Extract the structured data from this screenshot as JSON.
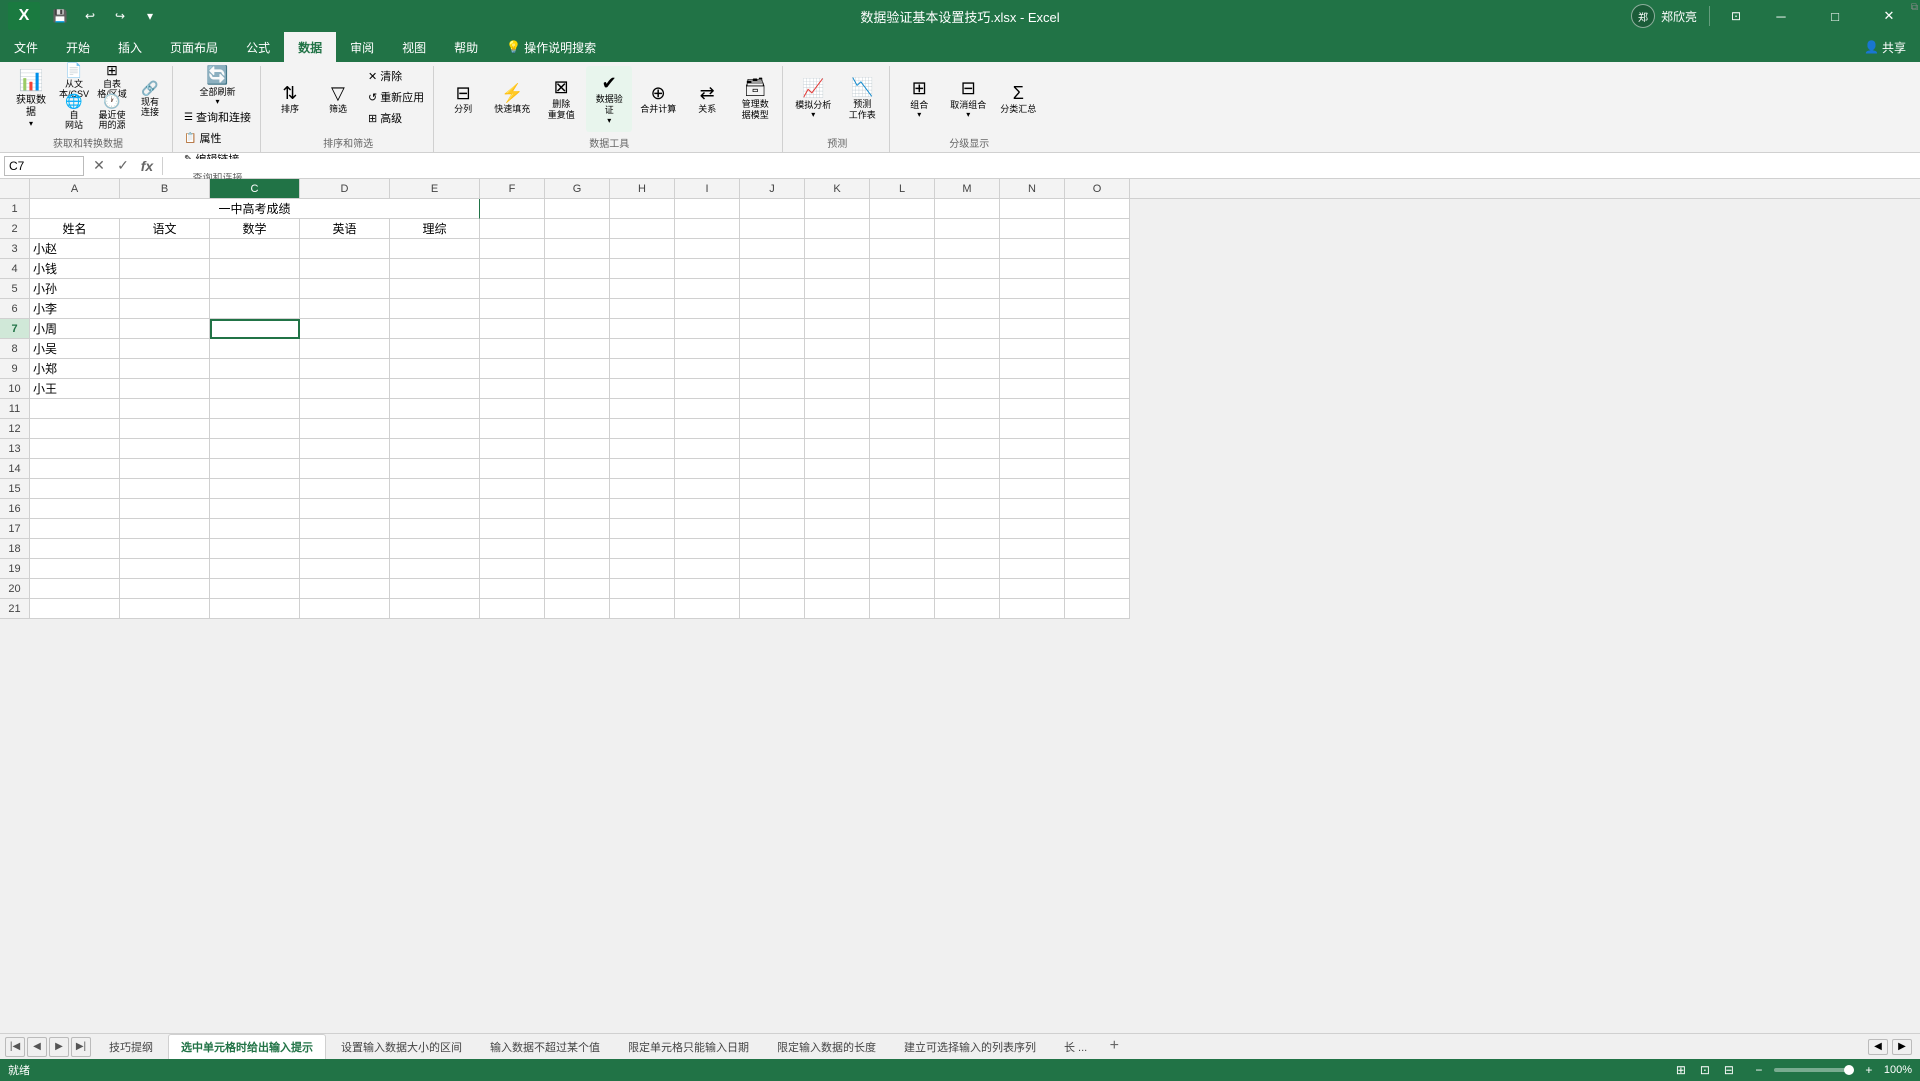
{
  "title_bar": {
    "file_title": "数据验证基本设置技巧.xlsx - Excel",
    "user_name": "郑欣亮",
    "min_label": "─",
    "max_label": "□",
    "close_label": "✕",
    "share_label": "共享"
  },
  "quick_access": {
    "save_label": "💾",
    "undo_label": "↩",
    "redo_label": "↪",
    "dropdown_label": "▾"
  },
  "ribbon": {
    "tabs": [
      "文件",
      "开始",
      "插入",
      "页面布局",
      "公式",
      "数据",
      "审阅",
      "视图",
      "帮助",
      "操作说明搜索"
    ],
    "active_tab": "数据",
    "groups": {
      "get_data": {
        "label": "获取和转换数据",
        "buttons": [
          "获取数\n据",
          "从文\n本/CSV",
          "自\n网站",
          "自表\n格/区域",
          "最近使\n用的源",
          "现有\n连接"
        ]
      },
      "query": {
        "label": "查询和连接",
        "buttons": [
          "全部刷新",
          "查询和连接",
          "属性",
          "编辑链接"
        ]
      },
      "sort_filter": {
        "label": "排序和筛选",
        "buttons": [
          "排序",
          "筛选",
          "清除",
          "重新应用",
          "高级"
        ]
      },
      "tools": {
        "label": "数据工具",
        "buttons": [
          "分列",
          "快速填充",
          "删除重复值",
          "数据验证",
          "合并计算",
          "关系",
          "管理数据模型"
        ]
      },
      "forecast": {
        "label": "预测",
        "buttons": [
          "模拟分析",
          "预测工作表"
        ]
      },
      "outline": {
        "label": "分级显示",
        "buttons": [
          "组合",
          "取消组合",
          "分类汇总"
        ]
      }
    }
  },
  "formula_bar": {
    "cell_ref": "C7",
    "cancel_icon": "✕",
    "confirm_icon": "✓",
    "function_icon": "fx"
  },
  "columns": [
    "A",
    "B",
    "C",
    "D",
    "E",
    "F",
    "G",
    "H",
    "I",
    "J",
    "K",
    "L",
    "M",
    "N",
    "O"
  ],
  "rows": [
    1,
    2,
    3,
    4,
    5,
    6,
    7,
    8,
    9,
    10,
    11,
    12,
    13,
    14,
    15,
    16,
    17,
    18,
    19,
    20,
    21
  ],
  "table_title": "一中高考成绩",
  "headers": [
    "姓名",
    "语文",
    "数学",
    "英语",
    "理综"
  ],
  "students": [
    "小赵",
    "小钱",
    "小孙",
    "小李",
    "小周",
    "小吴",
    "小郑",
    "小王"
  ],
  "selected_cell": "C7",
  "sheet_tabs": [
    "技巧提纲",
    "选中单元格时给出输入提示",
    "设置输入数据大小的区间",
    "输入数据不超过某个值",
    "限定单元格只能输入日期",
    "限定输入数据的长度",
    "建立可选择输入的列表序列",
    "长..."
  ],
  "active_sheet": "选中单元格时给出输入提示",
  "status": {
    "ready": "就绪",
    "zoom": "100%"
  }
}
